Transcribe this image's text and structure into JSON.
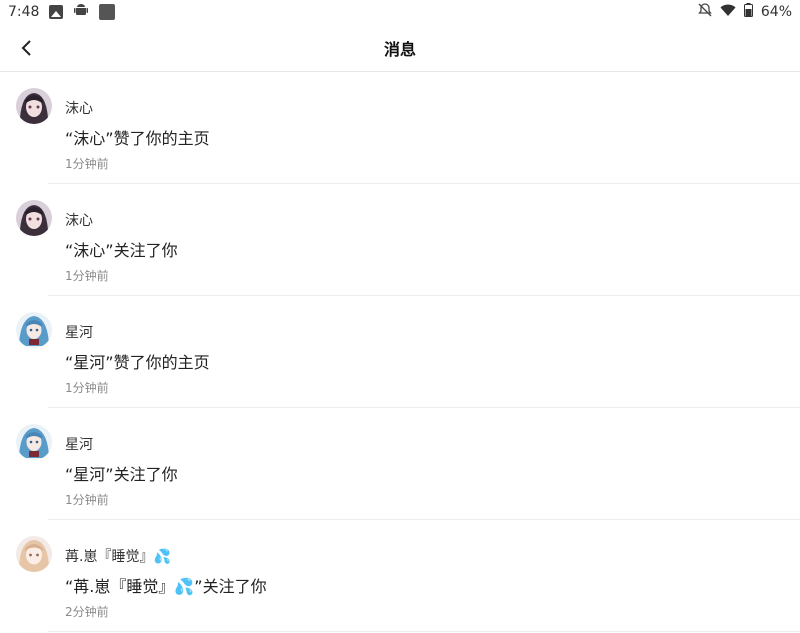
{
  "status_bar": {
    "time": "7:48",
    "battery": "64%"
  },
  "header": {
    "title": "消息"
  },
  "items": [
    {
      "name": "沫心",
      "message": "“沫心”赞了你的主页",
      "time": "1分钟前",
      "avatar": "avatar-dark-haired-girl"
    },
    {
      "name": "沫心",
      "message": "“沫心”关注了你",
      "time": "1分钟前",
      "avatar": "avatar-dark-haired-girl"
    },
    {
      "name": "星河",
      "message": "“星河”赞了你的主页",
      "time": "1分钟前",
      "avatar": "avatar-blue-haired-girl"
    },
    {
      "name": "星河",
      "message": "“星河”关注了你",
      "time": "1分钟前",
      "avatar": "avatar-blue-haired-girl"
    },
    {
      "name": "苒.崽『睡觉』💦",
      "message": "“苒.崽『睡觉』💦”关注了你",
      "time": "2分钟前",
      "avatar": "avatar-blonde-girl"
    }
  ],
  "colors": {
    "background": "#ffffff",
    "divider": "#ececec",
    "time_text": "#8a8a8a"
  }
}
